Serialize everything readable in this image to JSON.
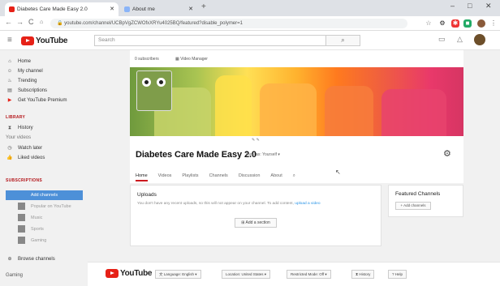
{
  "browser": {
    "tabs": [
      {
        "title": "Diabetes Care Made Easy 2.0",
        "active": true
      },
      {
        "title": "About me",
        "active": false
      }
    ],
    "url": "youtube.com/channel/UCBpVgZCWOfxXRYu4025BQ/featured?disable_polymer=1",
    "window_controls": [
      "–",
      "□",
      "✕"
    ]
  },
  "header": {
    "logo": "YouTube",
    "search_placeholder": "Search"
  },
  "sidebar": {
    "items": [
      {
        "label": "Home",
        "icon": "home-icon",
        "glyph": "⌂"
      },
      {
        "label": "My channel",
        "icon": "person-icon",
        "glyph": "☺"
      },
      {
        "label": "Trending",
        "icon": "flame-icon",
        "glyph": "♨"
      },
      {
        "label": "Subscriptions",
        "icon": "subscriptions-icon",
        "glyph": "▤"
      },
      {
        "label": "Get YouTube Premium",
        "icon": "youtube-icon",
        "glyph": "▶"
      }
    ],
    "library_heading": "LIBRARY",
    "library_items": [
      {
        "label": "History",
        "icon": "hourglass-icon",
        "glyph": "⧗"
      }
    ],
    "your_videos": "Your videos",
    "more_items": [
      {
        "label": "Watch later",
        "icon": "clock-icon",
        "glyph": "◷"
      },
      {
        "label": "Liked videos",
        "icon": "thumbs-up-icon",
        "glyph": "👍"
      }
    ],
    "subscriptions_heading": "SUBSCRIPTIONS",
    "add_channels": "Add channels",
    "subscriptions": [
      "Popular on YouTube",
      "Music",
      "Sports",
      "Gaming"
    ],
    "browse_channels": "Browse channels",
    "bottom_item": "Gaming"
  },
  "channel": {
    "subscribers": "0 subscribers",
    "video_manager": "Video Manager",
    "name": "Diabetes Care Made Easy 2.0",
    "view_as": "View as: Yourself ▾",
    "tabs": [
      "Home",
      "Videos",
      "Playlists",
      "Channels",
      "Discussion",
      "About"
    ],
    "uploads_title": "Uploads",
    "uploads_text": "You don't have any recent uploads, so this will not appear on your channel. To add content,",
    "uploads_link": "upload a video",
    "add_section": "Add a section",
    "featured_title": "Featured Channels",
    "add_featured": "+ Add channels"
  },
  "footer": {
    "logo": "YouTube",
    "buttons": [
      "Language: English ▾",
      "Location: United States ▾",
      "Restricted Mode: Off ▾",
      "History",
      "Help"
    ]
  },
  "colors": {
    "accent": "#cc181e",
    "link": "#2793e6",
    "add_button": "#4d90d8"
  }
}
